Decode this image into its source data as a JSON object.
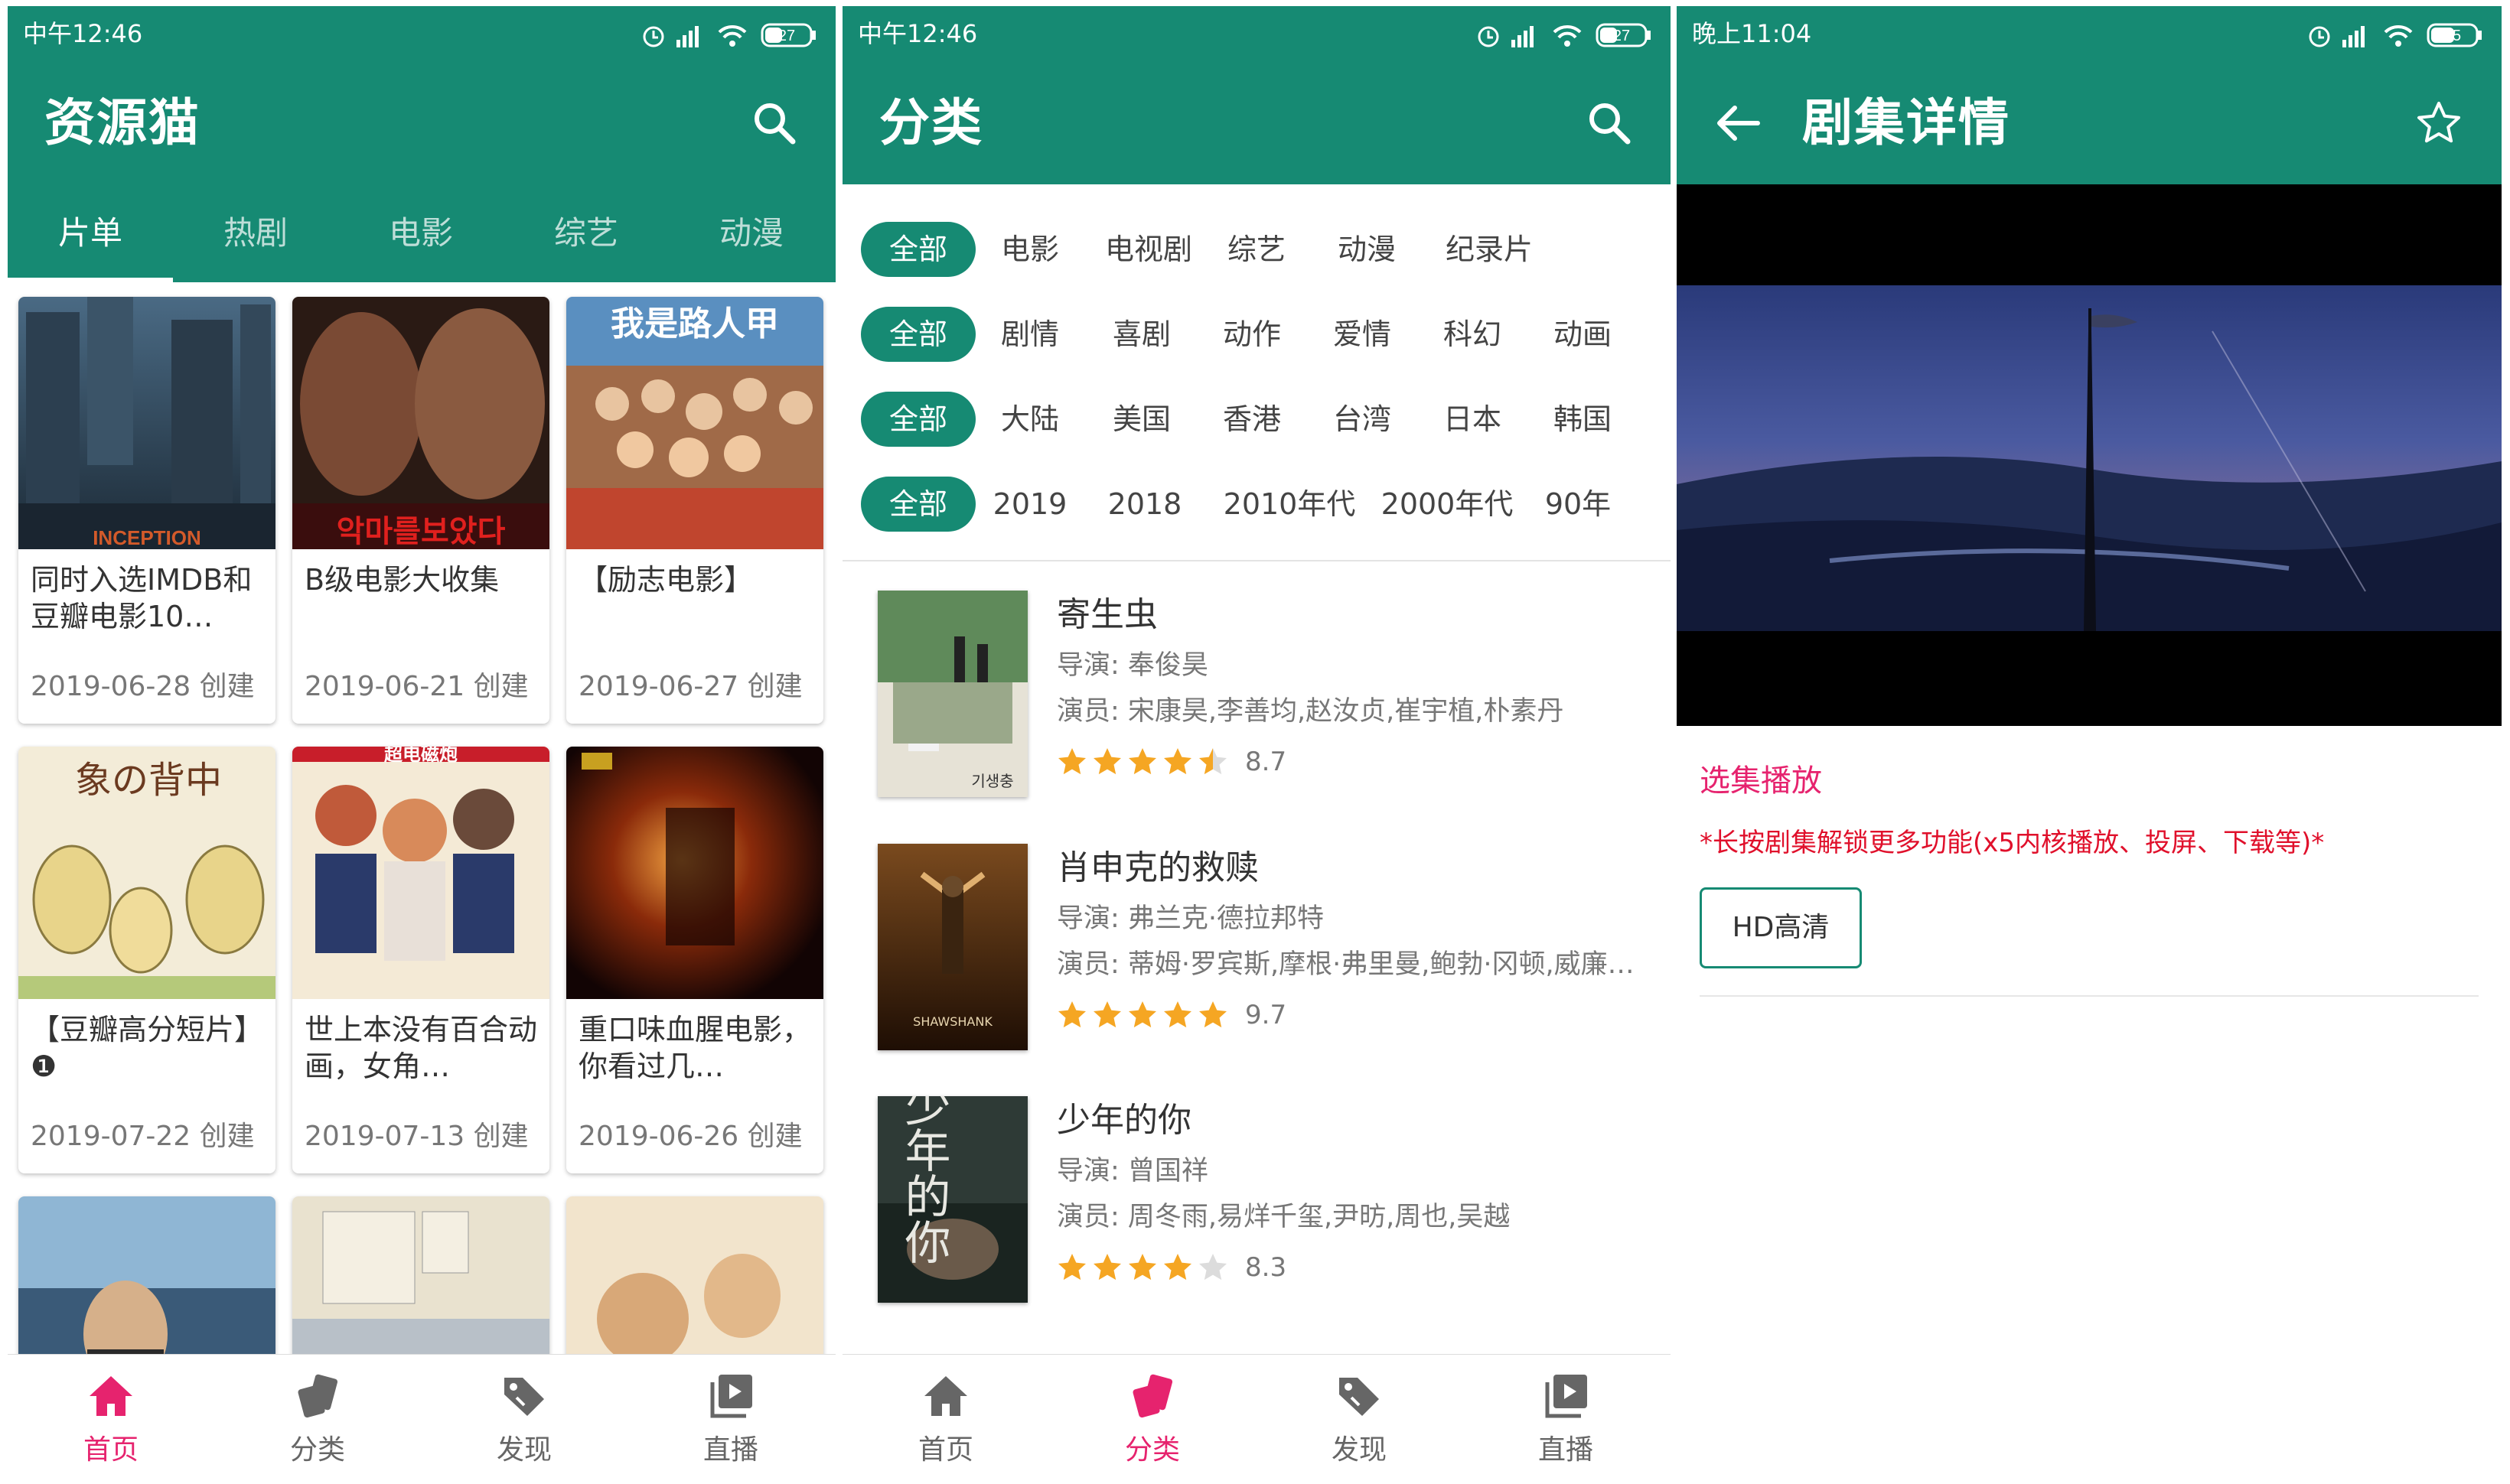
{
  "colors": {
    "primary": "#168a73",
    "accent": "#e6236e",
    "star": "#f5a623"
  },
  "left": {
    "status_time": "中午12:46",
    "battery": "27",
    "app_title": "资源猫",
    "tabs": [
      "片单",
      "热剧",
      "电影",
      "综艺",
      "动漫"
    ],
    "cards": [
      {
        "title": "同时入选IMDB和豆瓣电影10…",
        "date": "2019-06-28 创建",
        "poster_text": "INCEPTION"
      },
      {
        "title": "B级电影大收集",
        "date": "2019-06-21 创建",
        "poster_text": "악마를보았다"
      },
      {
        "title": "【励志电影】",
        "date": "2019-06-27 创建",
        "poster_text": "我是路人甲"
      },
      {
        "title": "【豆瓣高分短片】❶",
        "date": "2019-07-22 创建",
        "poster_text": "象の背中"
      },
      {
        "title": "世上本没有百合动画，女角…",
        "date": "2019-07-13 创建",
        "poster_text": "超电磁炮"
      },
      {
        "title": "重口味血腥电影，你看过几…",
        "date": "2019-06-26 创建",
        "poster_text": ""
      }
    ],
    "nav": [
      "首页",
      "分类",
      "发现",
      "直播"
    ]
  },
  "middle": {
    "status_time": "中午12:46",
    "battery": "27",
    "app_title": "分类",
    "filters": [
      [
        "全部",
        "电影",
        "电视剧",
        "综艺",
        "动漫",
        "纪录片"
      ],
      [
        "全部",
        "剧情",
        "喜剧",
        "动作",
        "爱情",
        "科幻",
        "动画"
      ],
      [
        "全部",
        "大陆",
        "美国",
        "香港",
        "台湾",
        "日本",
        "韩国"
      ],
      [
        "全部",
        "2019",
        "2018",
        "2010年代",
        "2000年代",
        "90年"
      ]
    ],
    "movies": [
      {
        "title": "寄生虫",
        "director": "导演: 奉俊昊",
        "actors": "演员: 宋康昊,李善均,赵汝贞,崔宇植,朴素丹",
        "score": "8.7",
        "rating": 4.5,
        "poster_text": "기생충"
      },
      {
        "title": "肖申克的救赎",
        "director": "导演: 弗兰克·德拉邦特",
        "actors": "演员: 蒂姆·罗宾斯,摩根·弗里曼,鲍勃·冈顿,威廉…",
        "score": "9.7",
        "rating": 5,
        "poster_text": "SHAWSHANK"
      },
      {
        "title": "少年的你",
        "director": "导演: 曾国祥",
        "actors": "演员: 周冬雨,易烊千玺,尹昉,周也,吴越",
        "score": "8.3",
        "rating": 4,
        "poster_text": "少年的你"
      }
    ],
    "nav": [
      "首页",
      "分类",
      "发现",
      "直播"
    ]
  },
  "right": {
    "status_time": "晚上11:04",
    "battery": "35",
    "app_title": "剧集详情",
    "section_title": "选集播放",
    "notice": "*长按剧集解锁更多功能(x5内核播放、投屏、下载等)*",
    "episode_button": "HD高清"
  }
}
